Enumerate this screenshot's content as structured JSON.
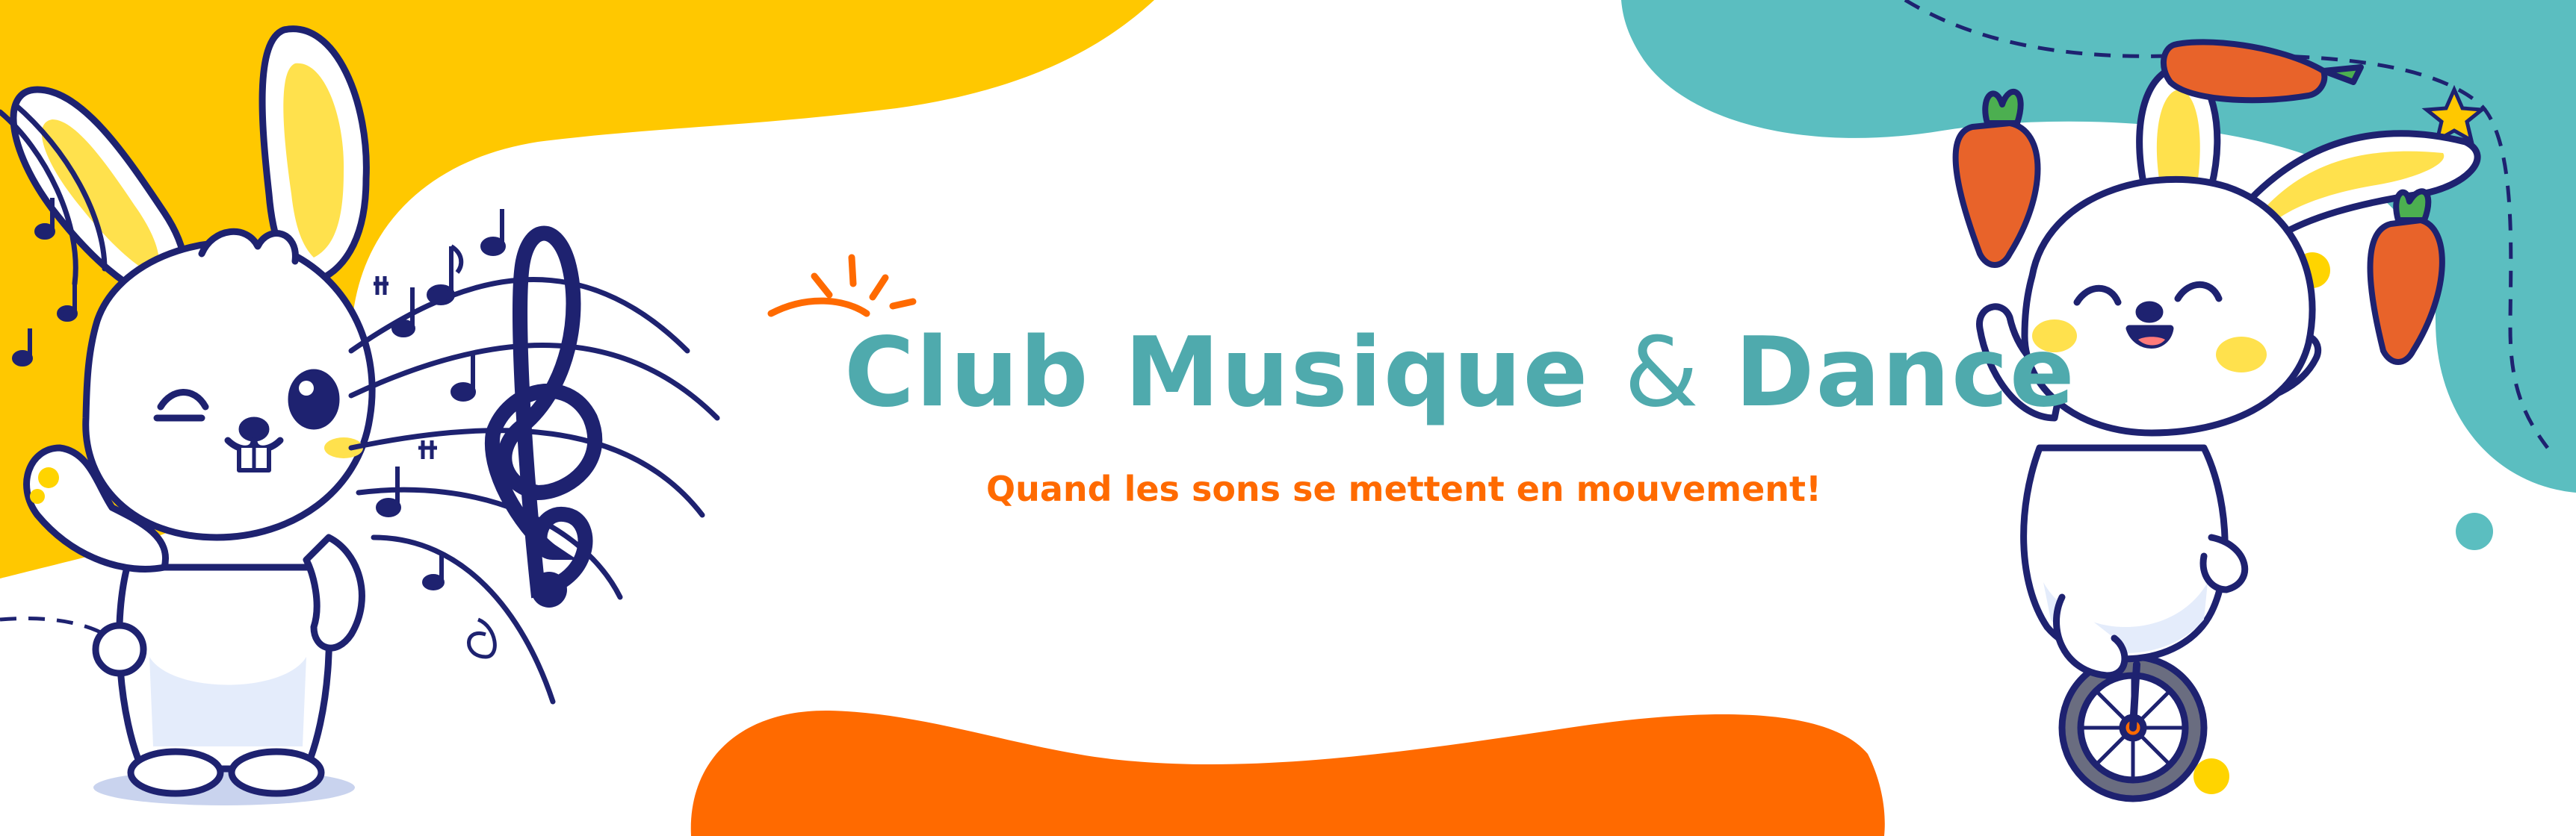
{
  "banner": {
    "title_part1": "Club Musique",
    "title_amp": "&",
    "title_part2": "Dance",
    "subtitle": "Quand les sons se mettent en mouvement!"
  },
  "colors": {
    "yellow": "#FFC800",
    "teal": "#5BBEC0",
    "orange": "#FF6A00",
    "navy": "#1E2270",
    "title_text": "#4FAAAD",
    "subtitle_text": "#FF6A00"
  },
  "icons": [
    "sun-rays-icon",
    "treble-clef-icon",
    "music-note-icon",
    "carrot-icon",
    "star-icon",
    "unicycle-icon"
  ]
}
